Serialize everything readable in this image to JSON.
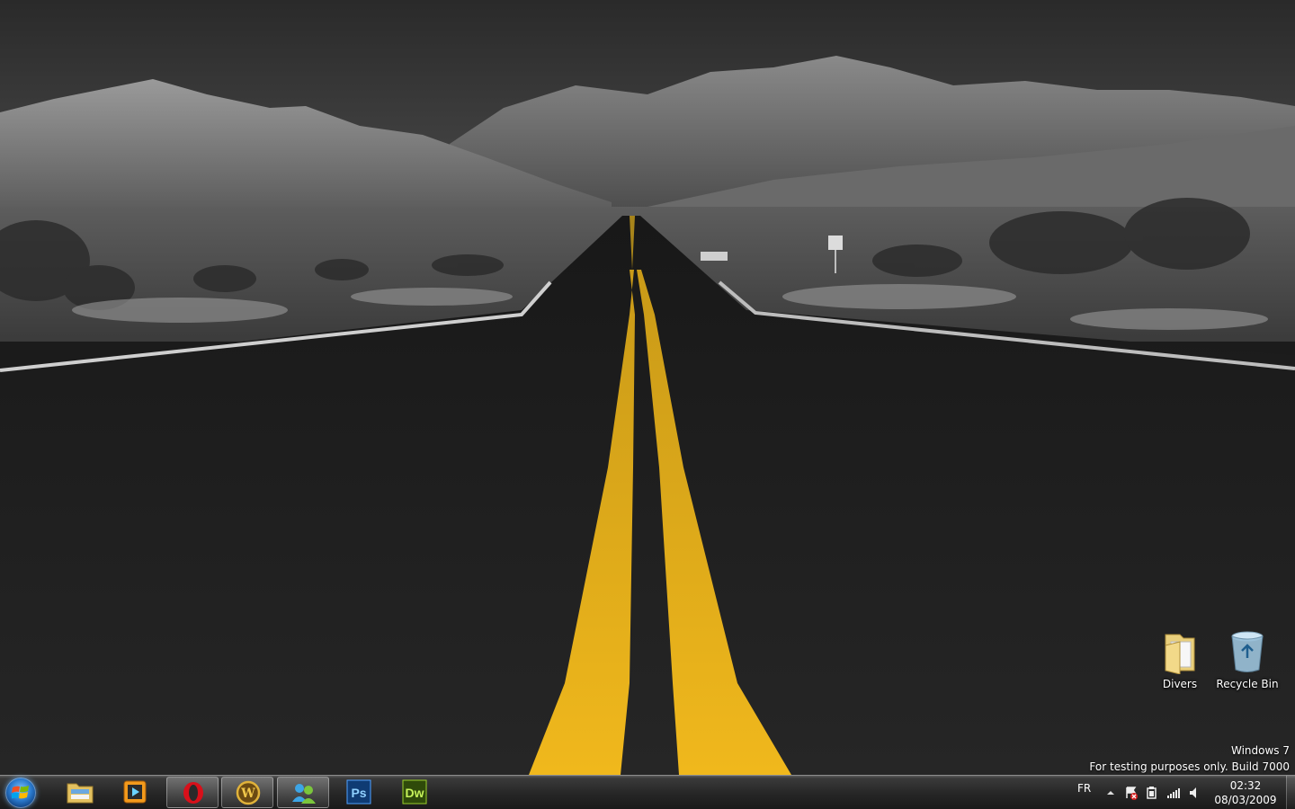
{
  "desktop": {
    "icons": [
      {
        "label": "Divers",
        "icon": "folder-icon"
      },
      {
        "label": "Recycle Bin",
        "icon": "recycle-bin-icon"
      }
    ],
    "watermark": {
      "line1": "Windows 7",
      "line2": "For testing purposes only. Build 7000"
    }
  },
  "taskbar": {
    "start_icon": "windows-logo-icon",
    "pinned": [
      {
        "icon": "windows-explorer-icon",
        "active": false
      },
      {
        "icon": "media-player-icon",
        "active": false
      },
      {
        "icon": "opera-browser-icon",
        "active": true
      },
      {
        "icon": "world-of-warcraft-icon",
        "active": true
      },
      {
        "icon": "messenger-icon",
        "active": true
      },
      {
        "icon": "photoshop-icon",
        "active": false,
        "text": "Ps"
      },
      {
        "icon": "dreamweaver-icon",
        "active": false,
        "text": "Dw"
      }
    ],
    "tray": {
      "language": "FR",
      "icons": [
        "show-hidden-icons-icon",
        "action-center-icon",
        "power-icon",
        "network-signal-icon",
        "volume-icon"
      ],
      "time": "02:32",
      "date": "08/03/2009"
    }
  },
  "colors": {
    "road_stripe": "#e8b21a",
    "asphalt": "#1e1e1e",
    "taskbar": "#262626"
  }
}
